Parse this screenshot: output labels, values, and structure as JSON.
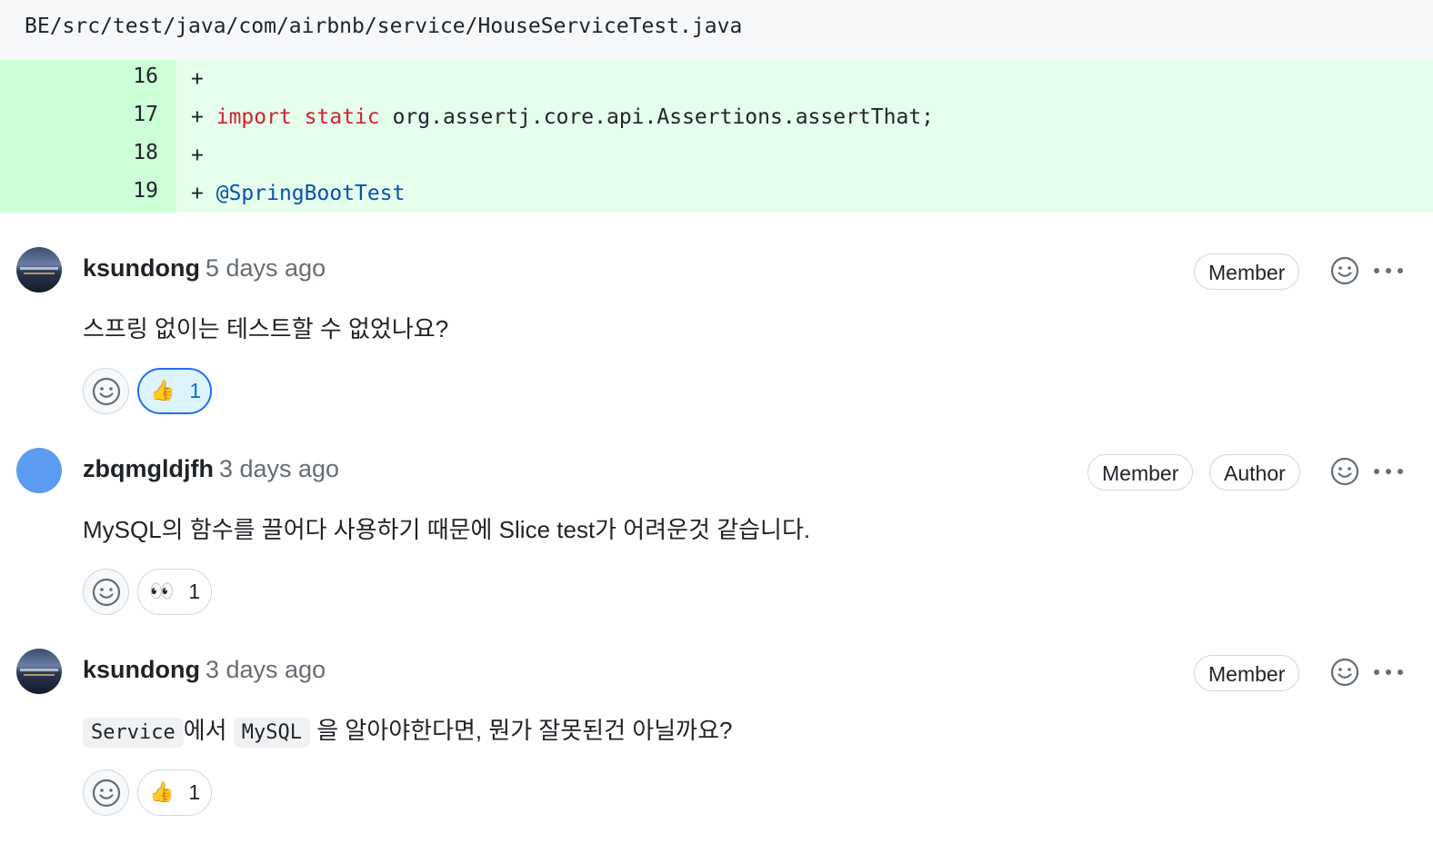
{
  "file": {
    "path": "BE/src/test/java/com/airbnb/service/HouseServiceTest.java"
  },
  "diff": [
    {
      "line": "16",
      "plus": "+",
      "kw": "",
      "text": "",
      "ann": ""
    },
    {
      "line": "17",
      "plus": "+",
      "kw": "import static",
      "text": " org.assertj.core.api.Assertions.assertThat;",
      "ann": ""
    },
    {
      "line": "18",
      "plus": "+",
      "kw": "",
      "text": "",
      "ann": ""
    },
    {
      "line": "19",
      "plus": "+",
      "kw": "",
      "text": "",
      "ann": "@SpringBootTest"
    }
  ],
  "comments": [
    {
      "author": "ksundong",
      "time": "5 days ago",
      "badges": [
        "Member"
      ],
      "body": "스프링 없이는 테스트할 수 없었나요?",
      "reaction": {
        "emoji": "👍",
        "count": "1",
        "active": true
      }
    },
    {
      "author": "zbqmgldjfh",
      "time": "3 days ago",
      "badges": [
        "Member",
        "Author"
      ],
      "body": "MySQL의 함수를 끌어다 사용하기 때문에 Slice test가 어려운것 같습니다.",
      "reaction": {
        "emoji": "👀",
        "count": "1",
        "active": false
      }
    },
    {
      "author": "ksundong",
      "time": "3 days ago",
      "badges": [
        "Member"
      ],
      "body_parts": {
        "code1": "Service",
        "t1": "에서 ",
        "code2": "MySQL",
        "t2": " 을 알아야한다면, 뭔가 잘못된건 아닐까요?"
      },
      "reaction": {
        "emoji": "👍",
        "count": "1",
        "active": false
      }
    }
  ],
  "icons": {
    "smile": "smiley-icon",
    "kebab": "kebab-horizontal-icon"
  }
}
